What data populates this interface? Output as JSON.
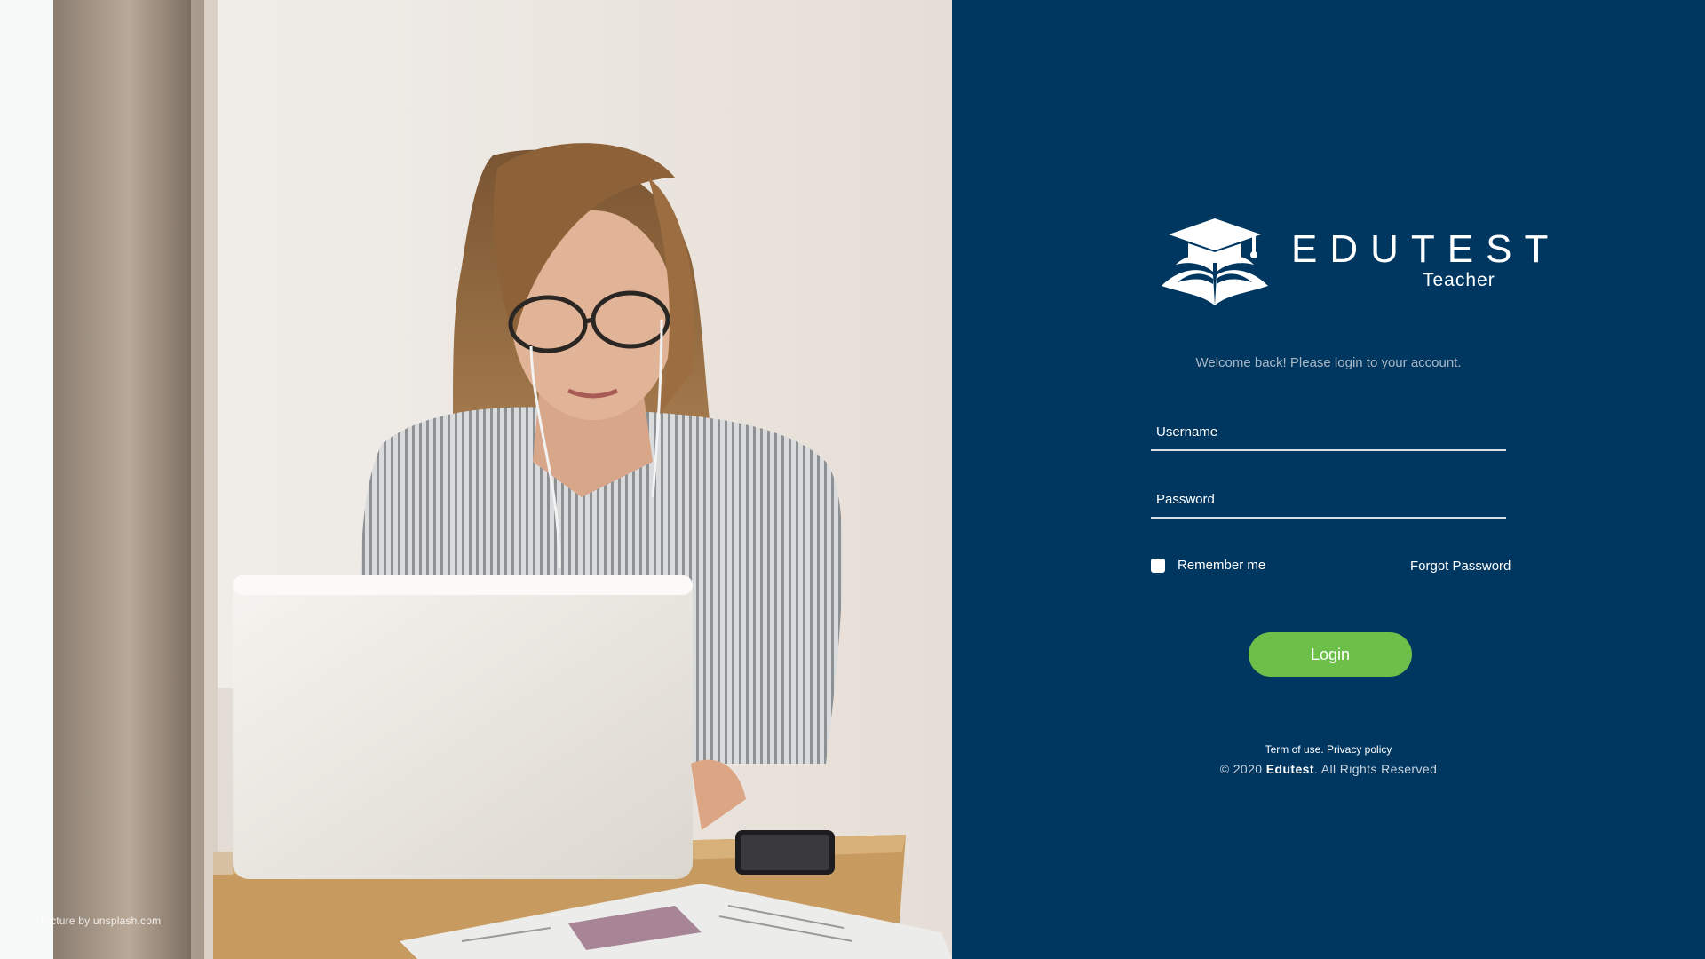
{
  "photo": {
    "credit": "Picture by unsplash.com"
  },
  "brand": {
    "name": "EDUTEST",
    "subtitle": "Teacher",
    "logo_icon": "graduation-cap-book-icon"
  },
  "login": {
    "welcome": "Welcome back! Please login to your account.",
    "username_label": "Username",
    "username_value": "",
    "password_label": "Password",
    "password_value": "",
    "remember_label": "Remember me",
    "remember_checked": false,
    "forgot_label": "Forgot Password",
    "submit_label": "Login"
  },
  "footer": {
    "terms_label": "Term of use.",
    "privacy_label": "Privacy policy",
    "copyright_prefix": "© 2020",
    "copyright_brand": "Edutest",
    "copyright_suffix": ". All Rights Reserved"
  },
  "colors": {
    "panel_background": "#003761",
    "button_green": "#6cc04a",
    "input_underline": "#d7dee6"
  }
}
